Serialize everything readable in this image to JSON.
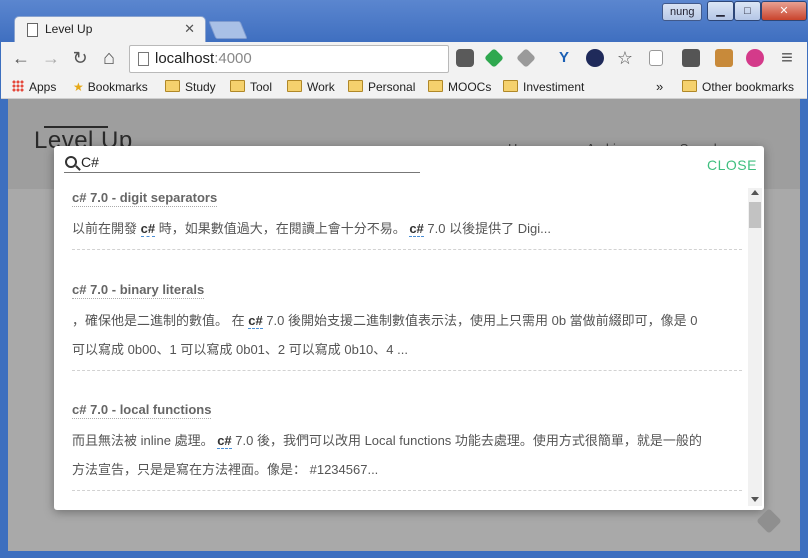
{
  "window": {
    "user": "nung",
    "tab_title": "Level Up",
    "tab_close": "✕",
    "buttons": {
      "minimize": "▁",
      "maximize": "□",
      "close": "✕"
    }
  },
  "toolbar": {
    "back": "←",
    "forward": "→",
    "reload": "↻",
    "home": "⌂",
    "url_host": "localhost",
    "url_port": ":4000",
    "star": "☆",
    "menu": "≡"
  },
  "bookmarks": {
    "apps": "Apps",
    "items": [
      "Bookmarks",
      "Study",
      "Tool",
      "Work",
      "Personal",
      "MOOCs",
      "Investiment"
    ],
    "overflow": "»",
    "other": "Other bookmarks"
  },
  "site": {
    "logo": "Level Up",
    "nav": [
      "Home",
      "Archives",
      "Search"
    ]
  },
  "search": {
    "query": "C#",
    "close_label": "CLOSE",
    "results": [
      {
        "title": "c# 7.0 - digit separators",
        "lines": [
          {
            "a": "以前在開發 ",
            "hl": "c#",
            "b": " 時，如果數值過大，在閱讀上會十分不易。 ",
            "hl2": "c#",
            "c": " 7.0 以後提供了 Digi..."
          }
        ]
      },
      {
        "title": "c# 7.0 - binary literals",
        "lines": [
          {
            "a": "，確保他是二進制的數值。 在 ",
            "hl": "c#",
            "b": " 7.0 後開始支援二進制數值表示法，使用上只需用 0b 當做前綴即可，像是 0"
          },
          {
            "a": "可以寫成 0b00、1 可以寫成 0b01、2 可以寫成 0b10、4 ..."
          }
        ]
      },
      {
        "title": "c# 7.0 - local functions",
        "lines": [
          {
            "a": "而且無法被 inline 處理。 ",
            "hl": "c#",
            "b": " 7.0 後，我們可以改用 Local functions 功能去處理。使用方式很簡單，就是一般的"
          },
          {
            "a": "方法宣告，只是是寫在方法裡面。像是： #1234567..."
          }
        ]
      }
    ]
  },
  "colors": {
    "close_accent": "#3fbf7f",
    "window_frame": "#3d6fbf",
    "overlay": "#a9a9a9"
  }
}
